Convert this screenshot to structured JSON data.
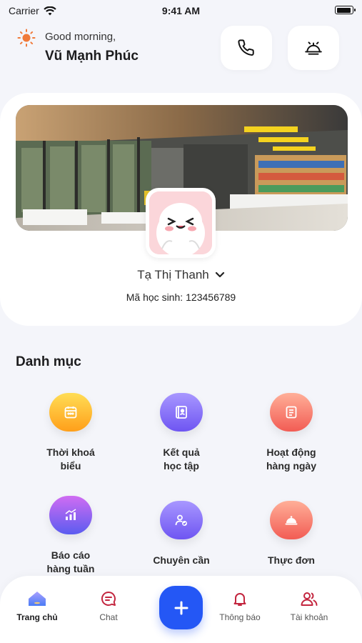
{
  "status_bar": {
    "carrier": "Carrier",
    "time": "9:41 AM"
  },
  "header": {
    "greeting": "Good morning,",
    "user_name": "Vũ Mạnh Phúc"
  },
  "profile": {
    "student_name": "Tạ Thị Thanh",
    "student_id_label": "Mã học sinh:",
    "student_id": "123456789"
  },
  "section_title": "Danh mục",
  "categories": [
    {
      "label": "Thời khoá\nbiểu",
      "icon": "calendar-icon",
      "color_from": "#ffd84d",
      "color_to": "#ff9f1a"
    },
    {
      "label": "Kết quả\nhọc tập",
      "icon": "report-book-icon",
      "color_from": "#a391ff",
      "color_to": "#6e55f2"
    },
    {
      "label": "Hoạt động\nhàng ngày",
      "icon": "clipboard-icon",
      "color_from": "#ffab93",
      "color_to": "#f25c54"
    },
    {
      "label": "Báo cáo\nhàng tuần",
      "icon": "chart-icon",
      "color_from": "#d06cf2",
      "color_to": "#5b5cf0"
    },
    {
      "label": "Chuyên cần",
      "icon": "attendance-icon",
      "color_from": "#a391ff",
      "color_to": "#6e55f2"
    },
    {
      "label": "Thực đơn",
      "icon": "food-cloche-icon",
      "color_from": "#ffab93",
      "color_to": "#f25c54"
    }
  ],
  "tabs": [
    {
      "label": "Trang chủ",
      "icon": "home-icon"
    },
    {
      "label": "Chat",
      "icon": "chat-icon"
    },
    {
      "label": "Thông báo",
      "icon": "bell-icon"
    },
    {
      "label": "Tài khoản",
      "icon": "users-icon"
    }
  ],
  "colors": {
    "accent": "#2457f5",
    "tab_icon": "#c3263f",
    "background": "#f4f5fa"
  }
}
